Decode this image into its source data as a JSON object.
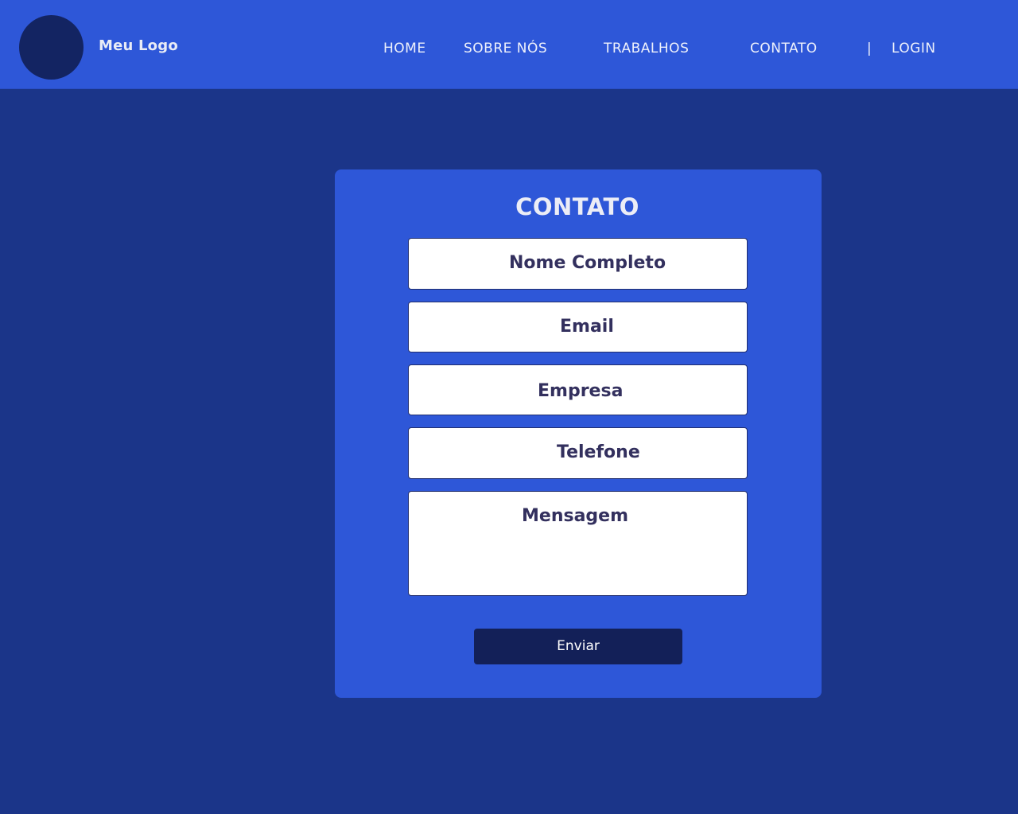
{
  "brand": {
    "logo_text": "Meu Logo"
  },
  "nav": {
    "items": [
      {
        "label": "HOME"
      },
      {
        "label": "SOBRE NÓS"
      },
      {
        "label": "TRABALHOS"
      },
      {
        "label": "CONTATO"
      }
    ],
    "separator": "|",
    "login_label": "LOGIN"
  },
  "form": {
    "title": "CONTATO",
    "fields": [
      {
        "placeholder": "Nome Completo"
      },
      {
        "placeholder": "Email"
      },
      {
        "placeholder": "Empresa"
      },
      {
        "placeholder": "Telefone"
      },
      {
        "placeholder": "Mensagem"
      }
    ],
    "submit_label": "Enviar"
  },
  "colors": {
    "header_bg": "#2e57d8",
    "page_bg": "#1b3589",
    "card_bg": "#2e57d8",
    "button_bg": "#132058",
    "logo_circle": "#132462"
  }
}
